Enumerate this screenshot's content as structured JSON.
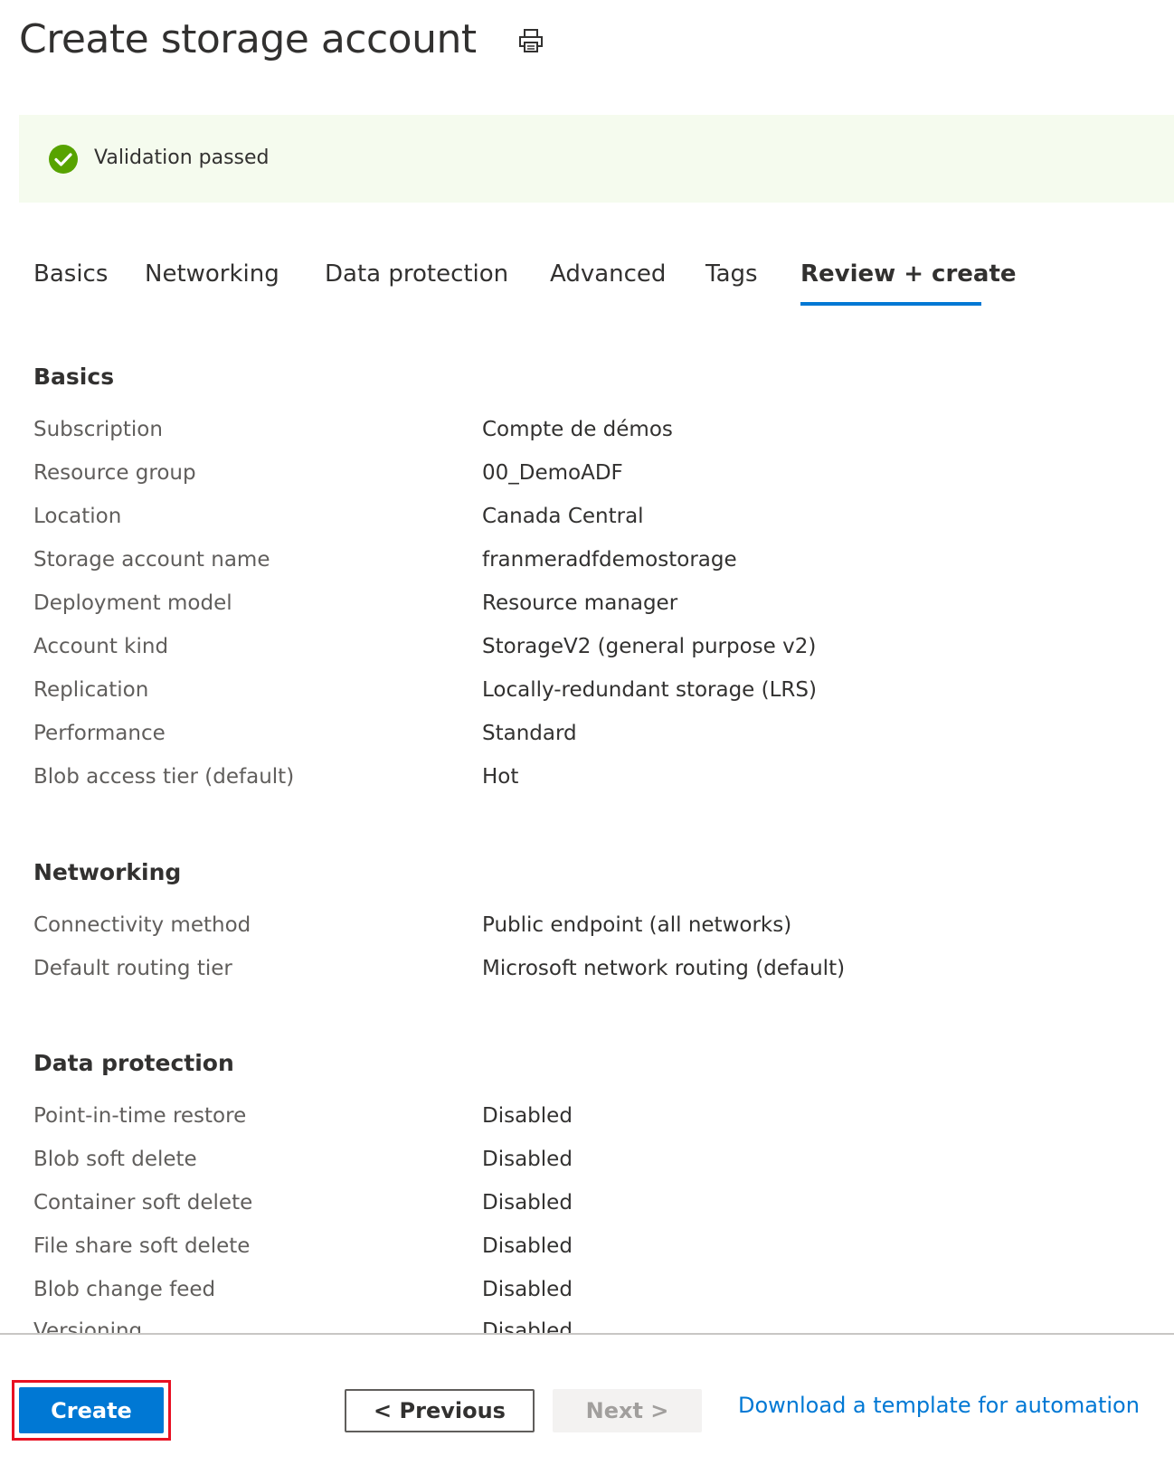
{
  "header": {
    "title": "Create storage account",
    "print_icon": "print-icon"
  },
  "validation": {
    "icon": "check-circle-icon",
    "text": "Validation passed",
    "status_color": "#57a300"
  },
  "tabs": [
    {
      "label": "Basics"
    },
    {
      "label": "Networking"
    },
    {
      "label": "Data protection"
    },
    {
      "label": "Advanced"
    },
    {
      "label": "Tags"
    },
    {
      "label": "Review + create",
      "active": true
    }
  ],
  "sections": {
    "basics": {
      "title": "Basics",
      "rows": [
        {
          "label": "Subscription",
          "value": "Compte de démos"
        },
        {
          "label": "Resource group",
          "value": "00_DemoADF"
        },
        {
          "label": "Location",
          "value": "Canada Central"
        },
        {
          "label": "Storage account name",
          "value": "franmeradfdemostorage"
        },
        {
          "label": "Deployment model",
          "value": "Resource manager"
        },
        {
          "label": "Account kind",
          "value": "StorageV2 (general purpose v2)"
        },
        {
          "label": "Replication",
          "value": "Locally-redundant storage (LRS)"
        },
        {
          "label": "Performance",
          "value": "Standard"
        },
        {
          "label": "Blob access tier (default)",
          "value": "Hot"
        }
      ]
    },
    "networking": {
      "title": "Networking",
      "rows": [
        {
          "label": "Connectivity method",
          "value": "Public endpoint (all networks)"
        },
        {
          "label": "Default routing tier",
          "value": "Microsoft network routing (default)"
        }
      ]
    },
    "data_protection": {
      "title": "Data protection",
      "rows": [
        {
          "label": "Point-in-time restore",
          "value": "Disabled"
        },
        {
          "label": "Blob soft delete",
          "value": "Disabled"
        },
        {
          "label": "Container soft delete",
          "value": "Disabled"
        },
        {
          "label": "File share soft delete",
          "value": "Disabled"
        },
        {
          "label": "Blob change feed",
          "value": "Disabled"
        },
        {
          "label": "Versioning",
          "value": "Disabled"
        }
      ]
    }
  },
  "footer": {
    "create_label": "Create",
    "previous_label": "< Previous",
    "next_label": "Next >",
    "download_link": "Download a template for automation"
  },
  "colors": {
    "accent": "#0078d4",
    "highlight_border": "#e81123",
    "validation_bg": "#f5fbee"
  }
}
